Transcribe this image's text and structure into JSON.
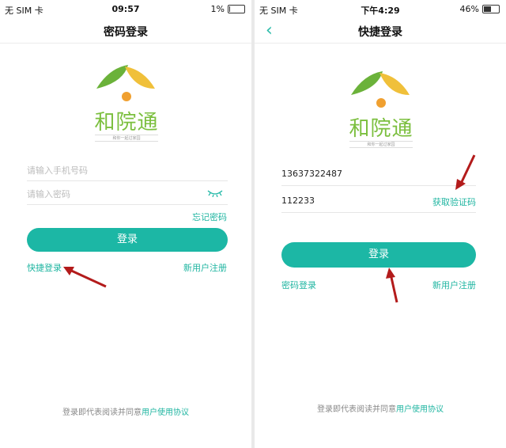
{
  "left": {
    "status": {
      "carrier": "无 SIM 卡",
      "time": "09:57",
      "battery": "1%"
    },
    "nav_title": "密码登录",
    "logo": {
      "brand": "和院通",
      "slogan": "和你一起过家园"
    },
    "phone_placeholder": "请输入手机号码",
    "password_placeholder": "请输入密码",
    "forgot_label": "忘记密码",
    "login_label": "登录",
    "quick_login_label": "快捷登录",
    "register_label": "新用户注册",
    "agreement_prefix": "登录即代表阅读并同意",
    "agreement_link": "用户使用协议"
  },
  "right": {
    "status": {
      "carrier": "无 SIM 卡",
      "time": "下午4:29",
      "battery": "46%"
    },
    "nav_title": "快捷登录",
    "logo": {
      "brand": "和院通",
      "slogan": "和你一起过家园"
    },
    "phone_value": "13637322487",
    "code_value": "112233",
    "get_code_label": "获取验证码",
    "login_label": "登录",
    "password_login_label": "密码登录",
    "register_label": "新用户注册",
    "agreement_prefix": "登录即代表阅读并同意",
    "agreement_link": "用户使用协议"
  },
  "colors": {
    "accent": "#1cb7a5",
    "logo_green": "#6bb23a",
    "logo_yellow": "#f0c03a",
    "arrow": "#b31b1b"
  }
}
